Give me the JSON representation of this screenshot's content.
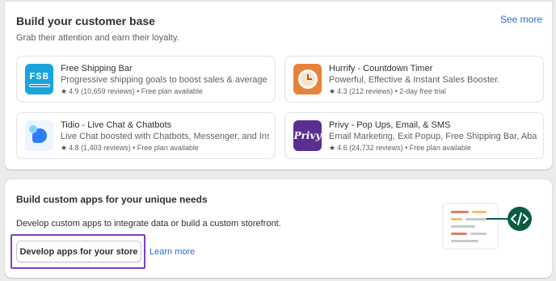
{
  "customer_base": {
    "title": "Build your customer base",
    "see_more": "See more",
    "subtitle": "Grab their attention and earn their loyalty.",
    "apps": [
      {
        "name": "Free Shipping Bar",
        "icon": "fsb-logo",
        "icon_text": "FSB",
        "description": "Progressive shipping goals to boost sales & average ca...",
        "rating": "4.9",
        "reviews": "(10,659 reviews)",
        "pricing": "Free plan available"
      },
      {
        "name": "Hurrify - Countdown Timer",
        "icon": "clock-logo",
        "description": "Powerful, Effective & Instant Sales Booster.",
        "rating": "4.3",
        "reviews": "(212 reviews)",
        "pricing": "2-day free trial"
      },
      {
        "name": "Tidio - Live Chat & Chatbots",
        "icon": "chat-bubble-logo",
        "description": "Live Chat boosted with Chatbots, Messenger, and Insta...",
        "rating": "4.8",
        "reviews": "(1,403 reviews)",
        "pricing": "Free plan available"
      },
      {
        "name": "Privy - Pop Ups, Email, & SMS",
        "icon": "privy-logo",
        "icon_text": "Privy",
        "description": "Email Marketing, Exit Popup, Free Shipping Bar, Aband...",
        "rating": "4.6",
        "reviews": "(24,732 reviews)",
        "pricing": "Free plan available"
      }
    ]
  },
  "custom_apps": {
    "title": "Build custom apps for your unique needs",
    "description": "Develop custom apps to integrate data or build a custom storefront.",
    "button_label": "Develop apps for your store",
    "learn_more": "Learn more"
  },
  "colors": {
    "link": "#2c6ecb",
    "highlight": "#7c3fbf",
    "code_badge": "#0b5c45"
  },
  "separator": " • ",
  "star_glyph": "★"
}
